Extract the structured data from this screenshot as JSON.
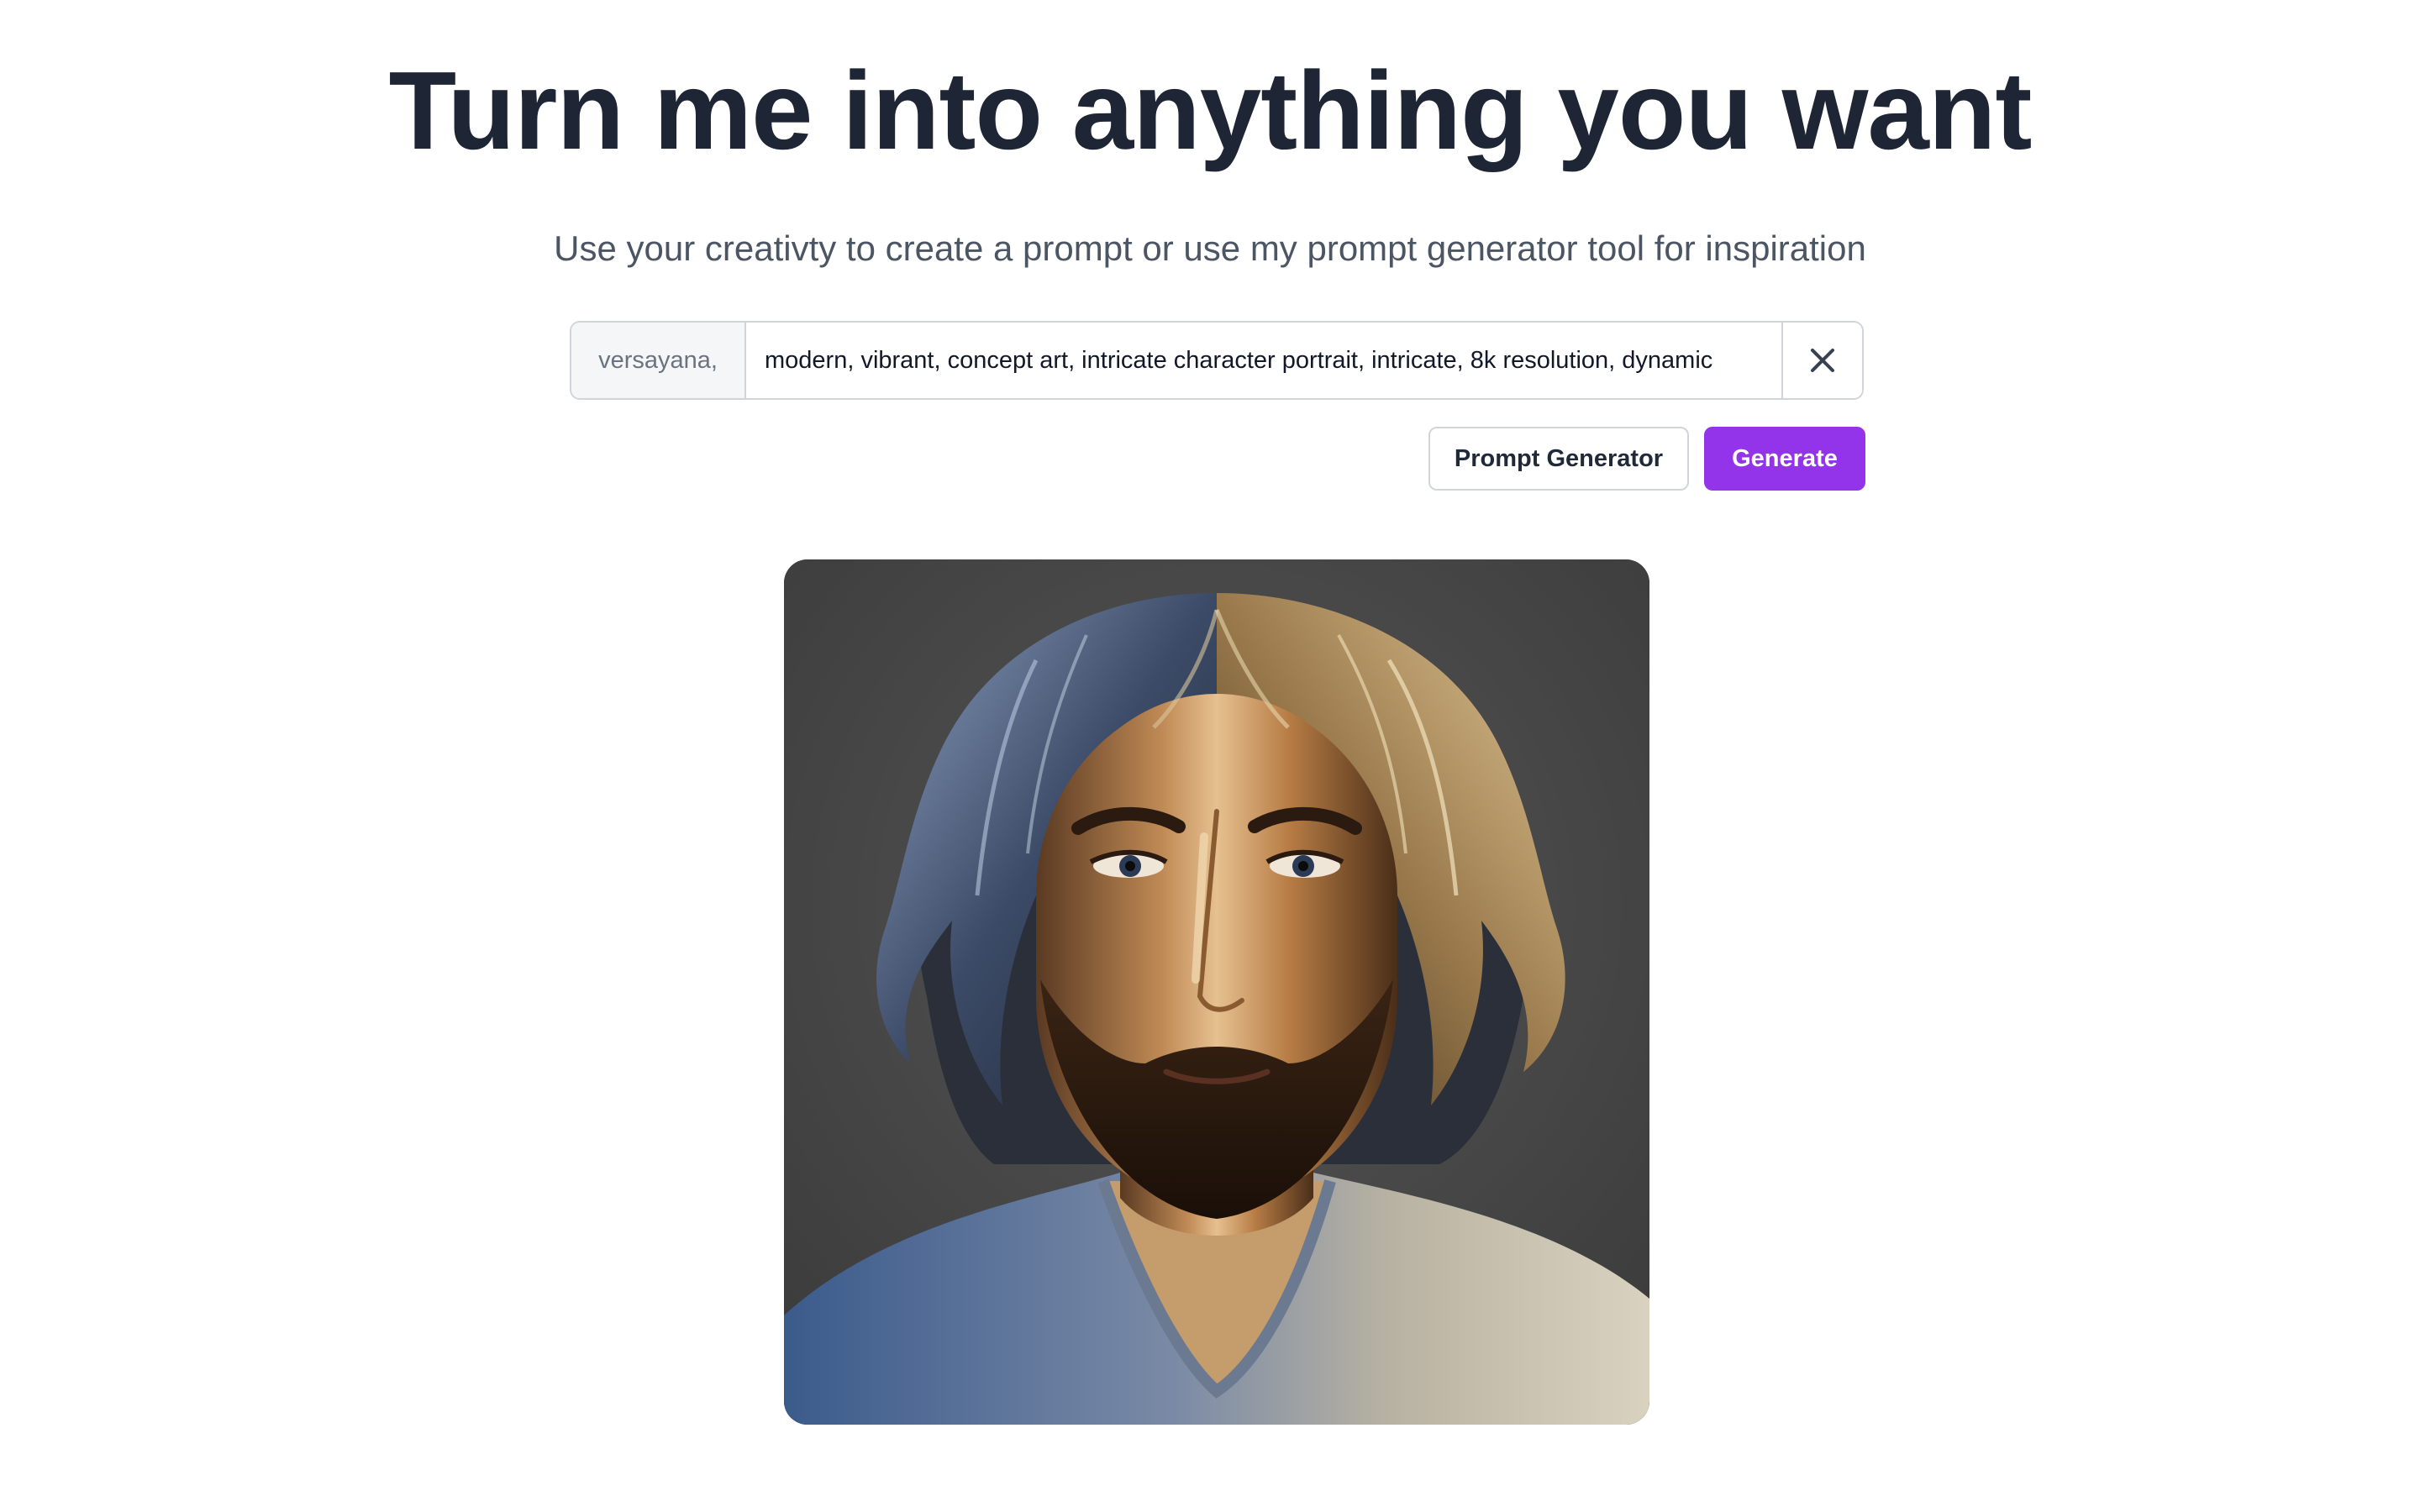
{
  "header": {
    "title": "Turn me into anything you want",
    "subtitle": "Use your creativty to create a prompt or use my prompt generator tool for inspiration"
  },
  "prompt": {
    "prefix": "versayana,",
    "value": "modern, vibrant, concept art, intricate character portrait, intricate, 8k resolution, dynamic",
    "clear_icon": "close-icon"
  },
  "actions": {
    "prompt_generator_label": "Prompt Generator",
    "generate_label": "Generate"
  },
  "colors": {
    "accent": "#9333ea",
    "title": "#1e2535",
    "subtitle": "#4b5563",
    "border": "#d1d5db"
  }
}
